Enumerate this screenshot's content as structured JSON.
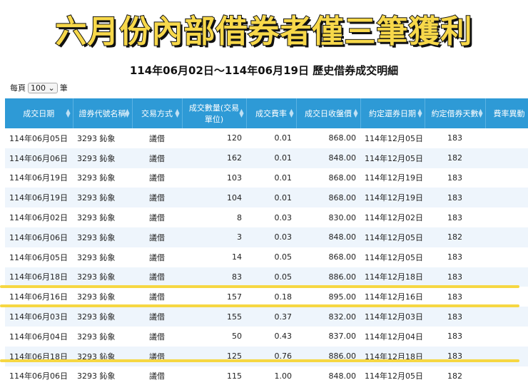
{
  "banner": "六月份內部借券者僅三筆獲利",
  "subtitle": "114年06月02日～114年06月19日 歷史借券成交明細",
  "perpage": {
    "prefix": "每頁",
    "value": "100",
    "suffix": "筆"
  },
  "columns": [
    "成交日期",
    "證券代號名稱",
    "交易方式",
    "成交數量(交易單位)",
    "成交費率",
    "成交日收盤價",
    "約定還券日期",
    "約定借券天數",
    "費率異動"
  ],
  "rows": [
    [
      "114年06月05日",
      "3293 鈊象",
      "議借",
      "120",
      "0.01",
      "868.00",
      "114年12月05日",
      "183"
    ],
    [
      "114年06月06日",
      "3293 鈊象",
      "議借",
      "162",
      "0.01",
      "848.00",
      "114年12月05日",
      "182"
    ],
    [
      "114年06月19日",
      "3293 鈊象",
      "議借",
      "103",
      "0.01",
      "868.00",
      "114年12月19日",
      "183"
    ],
    [
      "114年06月19日",
      "3293 鈊象",
      "議借",
      "104",
      "0.01",
      "868.00",
      "114年12月19日",
      "183"
    ],
    [
      "114年06月02日",
      "3293 鈊象",
      "議借",
      "8",
      "0.03",
      "830.00",
      "114年12月02日",
      "183"
    ],
    [
      "114年06月06日",
      "3293 鈊象",
      "議借",
      "3",
      "0.03",
      "848.00",
      "114年12月05日",
      "182"
    ],
    [
      "114年06月05日",
      "3293 鈊象",
      "議借",
      "14",
      "0.05",
      "868.00",
      "114年12月05日",
      "183"
    ],
    [
      "114年06月18日",
      "3293 鈊象",
      "議借",
      "83",
      "0.05",
      "886.00",
      "114年12月18日",
      "183"
    ],
    [
      "114年06月16日",
      "3293 鈊象",
      "議借",
      "157",
      "0.18",
      "895.00",
      "114年12月16日",
      "183"
    ],
    [
      "114年06月03日",
      "3293 鈊象",
      "議借",
      "155",
      "0.37",
      "832.00",
      "114年12月03日",
      "183"
    ],
    [
      "114年06月04日",
      "3293 鈊象",
      "議借",
      "50",
      "0.43",
      "837.00",
      "114年12月04日",
      "183"
    ],
    [
      "114年06月18日",
      "3293 鈊象",
      "議借",
      "125",
      "0.76",
      "886.00",
      "114年12月18日",
      "183"
    ],
    [
      "114年06月06日",
      "3293 鈊象",
      "議借",
      "115",
      "1.00",
      "848.00",
      "114年12月05日",
      "182"
    ]
  ],
  "colors": {
    "header": "#2e9ad6",
    "highlight": "#f6d743",
    "banner": "#f7d84a"
  }
}
